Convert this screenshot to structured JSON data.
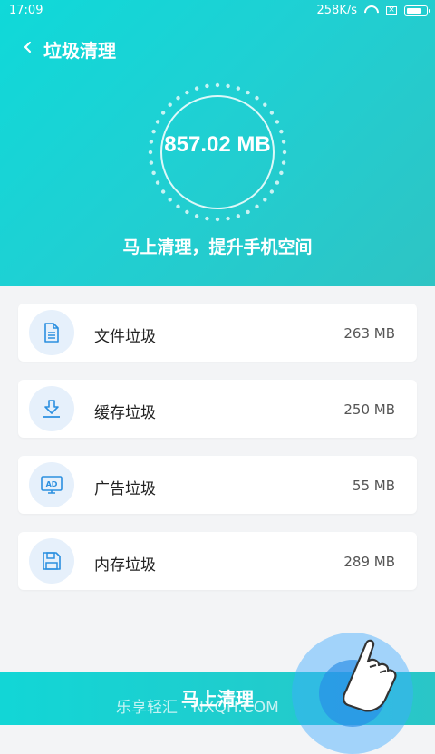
{
  "status_bar": {
    "time": "17:09",
    "speed": "258K/s",
    "battery_level": 0.9
  },
  "header": {
    "back_icon": "chevron-left-icon",
    "title": "垃圾清理"
  },
  "summary": {
    "total_size": "857.02 MB",
    "tagline": "马上清理，提升手机空间"
  },
  "items": [
    {
      "label": "文件垃圾",
      "size": "263 MB",
      "icon": "file-icon"
    },
    {
      "label": "缓存垃圾",
      "size": "250 MB",
      "icon": "download-icon"
    },
    {
      "label": "广告垃圾",
      "size": "55 MB",
      "icon": "ad-icon"
    },
    {
      "label": "内存垃圾",
      "size": "289 MB",
      "icon": "save-icon"
    }
  ],
  "action": {
    "clean_label": "马上清理"
  },
  "watermark": "乐享轻汇 · NXQH.COM",
  "colors": {
    "accent": "#1fd0d3",
    "icon_blue": "#2b8fe0",
    "icon_bg": "#e6f0fb"
  }
}
